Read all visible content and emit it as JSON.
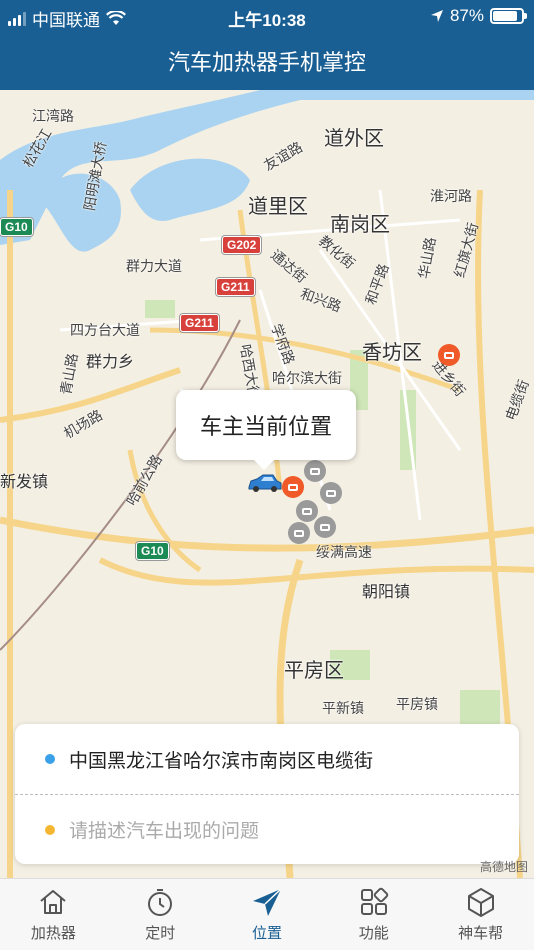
{
  "status_bar": {
    "carrier": "中国联通",
    "time": "上午10:38",
    "battery": "87%",
    "battery_level": 0.87
  },
  "header": {
    "title": "汽车加热器手机掌控"
  },
  "map": {
    "districts": [
      "道外区",
      "道里区",
      "南岗区",
      "香坊区",
      "平房区"
    ],
    "roads": [
      "江湾路",
      "松花江",
      "阳明滩大桥",
      "友谊路",
      "淮河路",
      "教化街",
      "通达街",
      "群力大道",
      "和兴路",
      "和平路",
      "华山路",
      "红旗大街",
      "四方台大道",
      "学府路",
      "青山路",
      "群力乡",
      "哈西大街",
      "机场路",
      "哈尔滨大街",
      "进乡街",
      "电缆街",
      "新发镇",
      "哈前公路",
      "绥满高速",
      "朝阳镇",
      "平新镇",
      "平房镇"
    ],
    "shields": [
      "G10",
      "G202",
      "G211",
      "G211",
      "G10"
    ],
    "callout": "车主当前位置",
    "attribution": "高德地图"
  },
  "location_card": {
    "address": "中国黑龙江省哈尔滨市南岗区电缆街",
    "problem_placeholder": "请描述汽车出现的问题",
    "address_dot_color": "#3aa0e8",
    "problem_dot_color": "#f5b731"
  },
  "tabs": [
    {
      "label": "加热器",
      "icon": "house-icon"
    },
    {
      "label": "定时",
      "icon": "timer-icon"
    },
    {
      "label": "位置",
      "icon": "location-arrow-icon"
    },
    {
      "label": "功能",
      "icon": "grid-icon"
    },
    {
      "label": "神车帮",
      "icon": "cube-icon"
    }
  ],
  "accent_color": "#1a5f93"
}
